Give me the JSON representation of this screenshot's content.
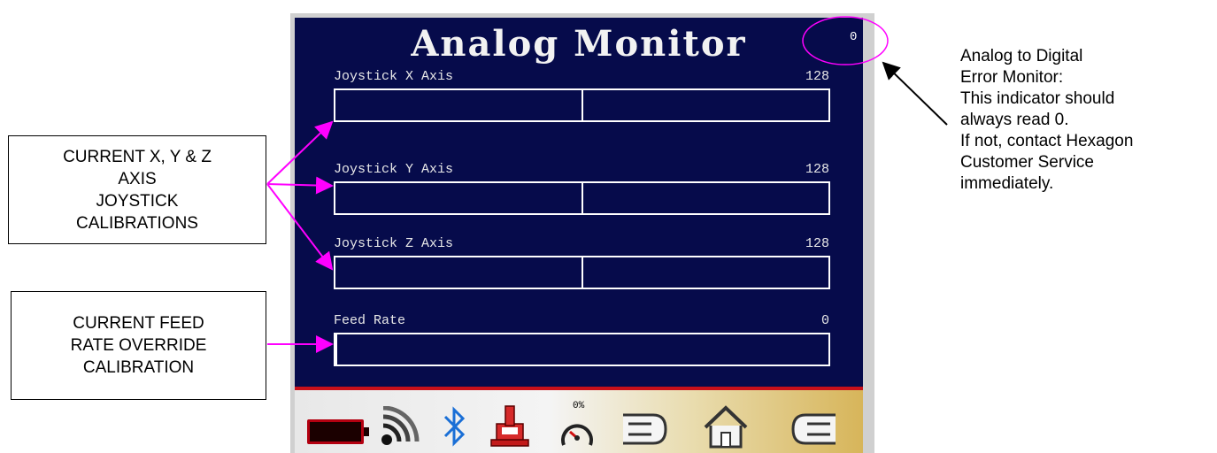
{
  "callouts": {
    "axes": "CURRENT X, Y & Z\nAXIS\nJOYSTICK\nCALIBRATIONS",
    "feed": "CURRENT FEED\nRATE OVERRIDE\nCALIBRATION",
    "error_note": "Analog to Digital\nError Monitor:\nThis indicator should\nalways read 0.\nIf not, contact Hexagon\nCustomer Service\nimmediately."
  },
  "screen": {
    "title": "Analog Monitor",
    "error_counter": "0",
    "rows": [
      {
        "label": "Joystick X Axis",
        "value": "128",
        "level": 0.5
      },
      {
        "label": "Joystick Y Axis",
        "value": "128",
        "level": 0.5
      },
      {
        "label": "Joystick Z Axis",
        "value": "128",
        "level": 0.5
      },
      {
        "label": "Feed Rate",
        "value": "0",
        "level": 0.0
      }
    ]
  },
  "toolbar": {
    "speed_percent": "0%",
    "icons": [
      "battery-icon",
      "wifi-icon",
      "bluetooth-icon",
      "robot-arm-icon",
      "speedometer-icon",
      "back-icon",
      "home-icon",
      "forward-icon"
    ]
  },
  "colors": {
    "screen_bg": "#060b4b",
    "annotation_magenta": "#ff00ff",
    "separator_red": "#c8101a"
  }
}
